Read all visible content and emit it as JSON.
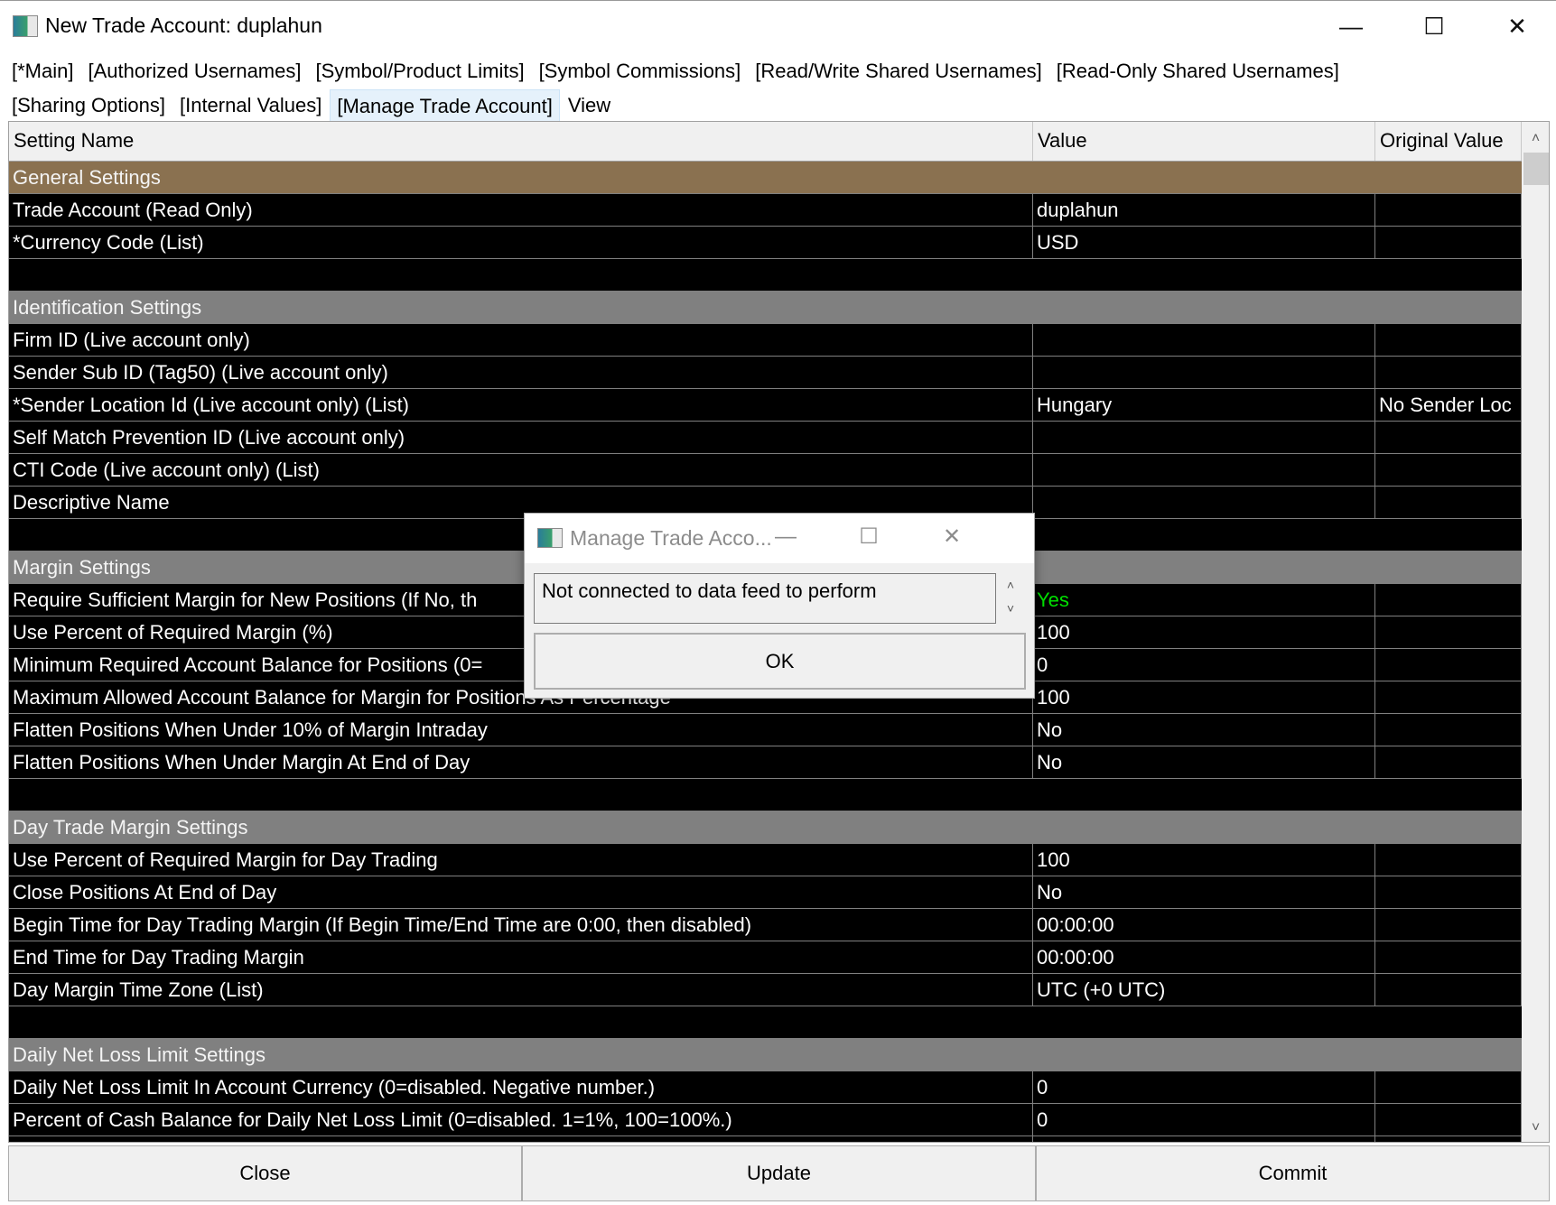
{
  "window": {
    "title": "New Trade Account: duplahun",
    "minimize": "—",
    "maximize": "☐",
    "close": "✕"
  },
  "tabs": {
    "row1": [
      "[*Main]",
      "[Authorized Usernames]",
      "[Symbol/Product Limits]",
      "[Symbol Commissions]",
      "[Read/Write Shared Usernames]",
      "[Read-Only Shared Usernames]"
    ],
    "row2": [
      "[Sharing Options]",
      "[Internal Values]",
      "[Manage Trade Account]",
      "View"
    ],
    "active": "[Manage Trade Account]"
  },
  "grid": {
    "columns": [
      "Setting Name",
      "Value",
      "Original Value"
    ],
    "rows": [
      {
        "type": "section",
        "name": "General Settings",
        "color": "#8a7150"
      },
      {
        "name": "Trade Account (Read Only)",
        "value": "duplahun",
        "original": ""
      },
      {
        "name": "*Currency Code (List)",
        "value": "USD",
        "original": ""
      },
      {
        "type": "blank"
      },
      {
        "type": "section",
        "name": "Identification Settings"
      },
      {
        "name": "Firm ID (Live account only)",
        "value": "",
        "original": ""
      },
      {
        "name": "Sender Sub ID (Tag50) (Live account only)",
        "value": "",
        "original": ""
      },
      {
        "name": "*Sender Location Id (Live account only) (List)",
        "value": "Hungary",
        "original": "No Sender Loc"
      },
      {
        "name": "Self Match Prevention ID (Live account only)",
        "value": "",
        "original": ""
      },
      {
        "name": "CTI Code (Live account only) (List)",
        "value": "",
        "original": ""
      },
      {
        "name": "Descriptive Name",
        "value": "",
        "original": ""
      },
      {
        "type": "blank"
      },
      {
        "type": "section",
        "name": "Margin Settings"
      },
      {
        "name": "Require Sufficient Margin for New Positions (If No, th",
        "value": "Yes",
        "value_color": "#00e000",
        "original": ""
      },
      {
        "name": "Use Percent of Required Margin (%)",
        "value": "100",
        "original": ""
      },
      {
        "name": "Minimum Required Account Balance for Positions (0=",
        "value": "0",
        "original": ""
      },
      {
        "name": "Maximum Allowed Account Balance for Margin for Positions As Percentage",
        "value": "100",
        "original": ""
      },
      {
        "name": "Flatten Positions When Under 10% of Margin Intraday",
        "value": "No",
        "original": ""
      },
      {
        "name": "Flatten Positions When Under Margin At End of Day",
        "value": "No",
        "original": ""
      },
      {
        "type": "blank"
      },
      {
        "type": "section",
        "name": "Day Trade Margin Settings"
      },
      {
        "name": "Use Percent of Required Margin for Day Trading",
        "value": "100",
        "original": ""
      },
      {
        "name": "Close Positions At End of Day",
        "value": "No",
        "original": ""
      },
      {
        "name": "Begin Time for Day Trading Margin (If Begin Time/End Time are 0:00, then disabled)",
        "value": "00:00:00",
        "original": ""
      },
      {
        "name": "End Time for Day Trading Margin",
        "value": "00:00:00",
        "original": ""
      },
      {
        "name": "Day Margin Time Zone (List)",
        "value": "UTC (+0 UTC)",
        "original": ""
      },
      {
        "type": "blank"
      },
      {
        "type": "section",
        "name": "Daily Net Loss Limit Settings"
      },
      {
        "name": "Daily Net Loss Limit In Account Currency (0=disabled. Negative number.)",
        "value": "0",
        "original": ""
      },
      {
        "name": "Percent of Cash Balance for Daily Net Loss Limit (0=disabled. 1=1%, 100=100%.)",
        "value": "0",
        "original": ""
      },
      {
        "name": "",
        "value": "",
        "original": ""
      }
    ]
  },
  "scrollbar": {
    "up": "˄",
    "down": "˅"
  },
  "buttons": {
    "close": "Close",
    "update": "Update",
    "commit": "Commit"
  },
  "dialog": {
    "title": "Manage Trade Acco...",
    "minimize": "—",
    "maximize": "☐",
    "close": "✕",
    "message": "Not connected to data feed to perform",
    "spin_up": "˄",
    "spin_down": "˅",
    "ok": "OK"
  }
}
